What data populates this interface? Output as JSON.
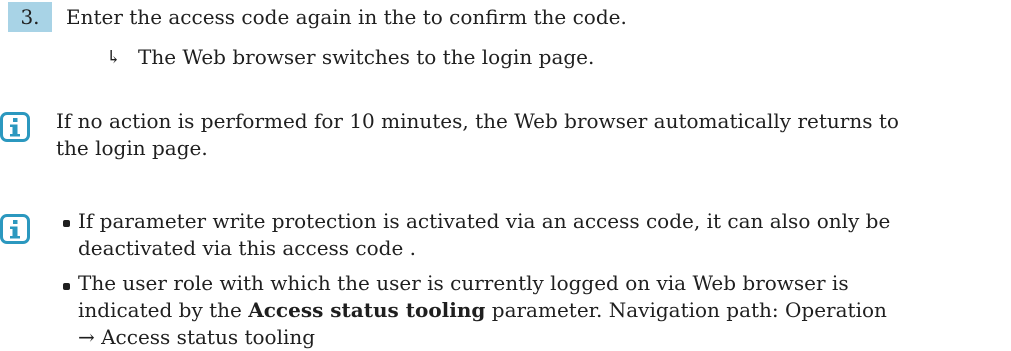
{
  "step": {
    "number": "3.",
    "text": "Enter the access code again in the to confirm the code.",
    "result_arrow": "↳",
    "result_text": "The Web browser switches to the login page."
  },
  "note1": {
    "icon": "info-icon",
    "line1": "If no action is performed for 10 minutes, the Web browser automatically returns to",
    "line2": "the login page."
  },
  "note2": {
    "icon": "info-icon",
    "bullet1_line1": "If parameter write protection is activated via an access code, it can also only be",
    "bullet1_line2": "deactivated via this access code .",
    "bullet2_line1": "The user role with which the user is currently logged on via Web browser is",
    "bullet2_line2_pre": "indicated by the ",
    "bullet2_line2_bold": "Access status tooling",
    "bullet2_line2_post": " parameter. Navigation path: Operation",
    "bullet2_line3": "→ Access status tooling"
  },
  "colors": {
    "step_badge": "#a8d3e6",
    "info_icon": "#2b98bf",
    "text": "#1f1f1f"
  }
}
